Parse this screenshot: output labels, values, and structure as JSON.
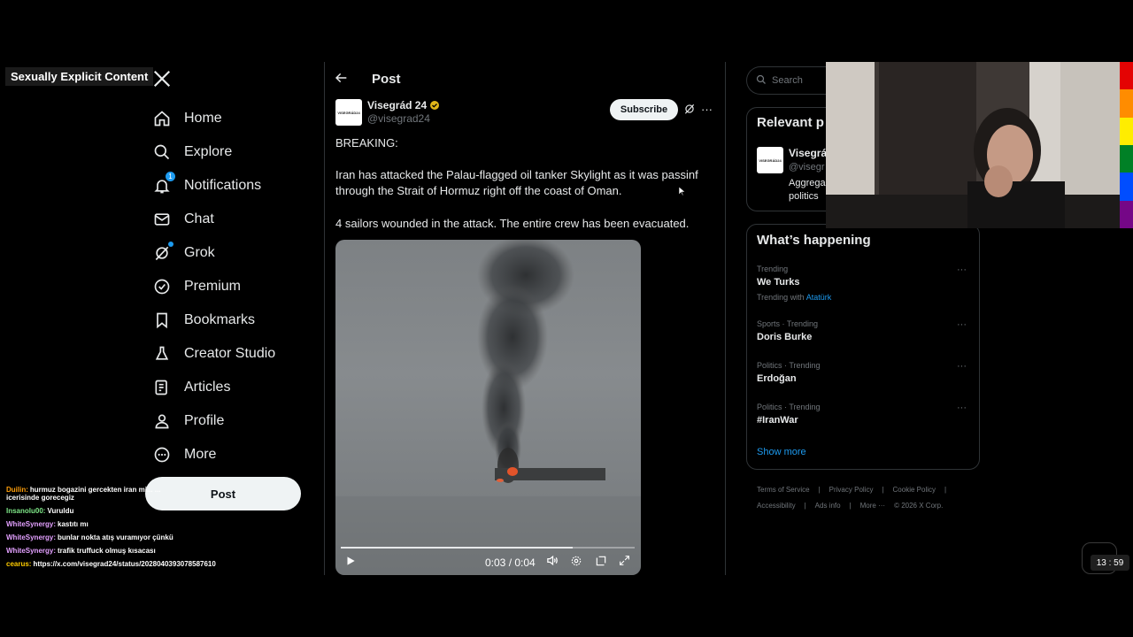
{
  "overlay": {
    "label": "Sexually Explicit Content"
  },
  "nav": {
    "items": [
      {
        "label": "Home",
        "icon": "home-icon"
      },
      {
        "label": "Explore",
        "icon": "search-icon"
      },
      {
        "label": "Notifications",
        "icon": "bell-icon",
        "badge": "1"
      },
      {
        "label": "Chat",
        "icon": "mail-icon"
      },
      {
        "label": "Grok",
        "icon": "grok-icon"
      },
      {
        "label": "Premium",
        "icon": "verified-badge-icon"
      },
      {
        "label": "Bookmarks",
        "icon": "bookmark-icon"
      },
      {
        "label": "Creator Studio",
        "icon": "flask-icon"
      },
      {
        "label": "Articles",
        "icon": "article-icon"
      },
      {
        "label": "Profile",
        "icon": "person-icon"
      },
      {
        "label": "More",
        "icon": "more-circle-icon"
      }
    ],
    "post_button": "Post"
  },
  "chat": [
    {
      "user": "Duilin:",
      "color": "#ff9f0a",
      "text": "hurmuz bogazini gercekten iran mi... ...",
      "text2": "icerisinde gorecegiz"
    },
    {
      "user": "Insanolu00:",
      "color": "#7ee787",
      "text": "Vuruldu"
    },
    {
      "user": "WhiteSynergy:",
      "color": "#e3a0ff",
      "text": "kastıtı mı"
    },
    {
      "user": "WhiteSynergy:",
      "color": "#e3a0ff",
      "text": "bunlar nokta atış vuramıyor çünkü"
    },
    {
      "user": "WhiteSynergy:",
      "color": "#e3a0ff",
      "text": "trafik truffuck olmuş kısacası"
    },
    {
      "user": "cearus:",
      "color": "#ffcc00",
      "text": "https://x.com/visegrad24/status/2028040393078587610"
    }
  ],
  "post": {
    "header_title": "Post",
    "author_name": "Visegrád 24",
    "author_handle": "@visegrad24",
    "avatar_text": "VISEGRÁD24",
    "subscribe_label": "Subscribe",
    "text_1": "BREAKING:",
    "text_2": "Iran has attacked the Palau-flagged oil tanker Skylight as it was passinf through the Strait of Hormuz right off the coast of Oman.",
    "text_3": "4 sailors wounded in the attack. The entire crew has been evacuated.",
    "video": {
      "time": "0:03 / 0:04",
      "progress": 0.79
    }
  },
  "sidebar": {
    "search_placeholder": "Search",
    "relevant_title": "Relevant p",
    "relevant_name": "Visegrá",
    "relevant_handle": "@visegr",
    "relevant_bio_1": "Aggrega",
    "relevant_bio_2": "politics",
    "happening_title": "What’s happening",
    "trends": [
      {
        "meta": "Trending",
        "name": "We Turks",
        "with_label": "Trending with",
        "with_link": "Atatürk"
      },
      {
        "meta": "Sports · Trending",
        "name": "Doris Burke"
      },
      {
        "meta": "Politics · Trending",
        "name": "Erdoğan"
      },
      {
        "meta": "Politics · Trending",
        "name": "#IranWar"
      }
    ],
    "show_more": "Show more",
    "footer_row1": [
      "Terms of Service",
      "|",
      "Privacy Policy",
      "|",
      "Cookie Policy",
      "|"
    ],
    "footer_row2": [
      "Accessibility",
      "|",
      "Ads info",
      "|",
      "More ···",
      "© 2026 X Corp."
    ]
  },
  "clock": "13 : 59",
  "colors": {
    "accent": "#1d9bf0",
    "bg": "#000000",
    "border": "#2f3336"
  }
}
